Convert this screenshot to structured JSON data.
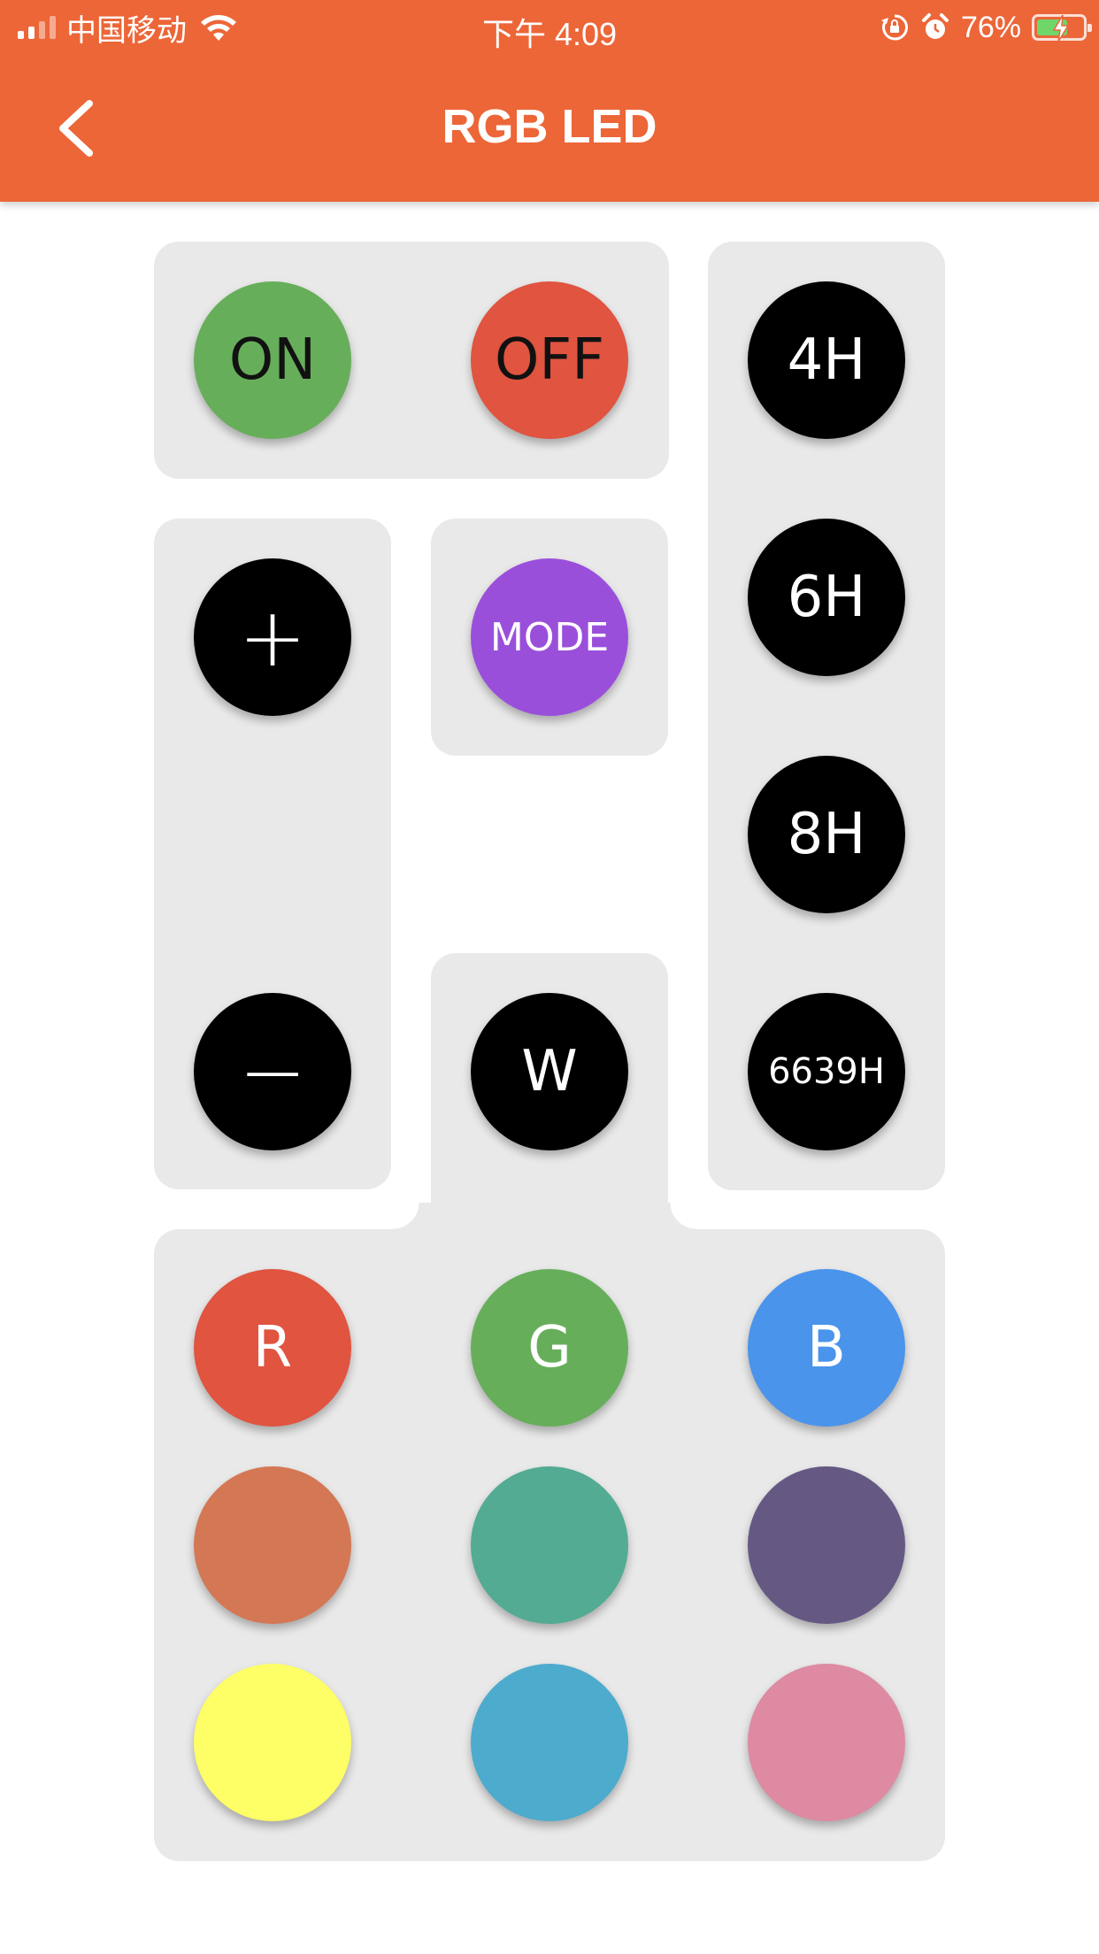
{
  "status_bar": {
    "carrier": "中国移动",
    "time": "下午 4:09",
    "battery": "76%",
    "icons": [
      "signal-icon",
      "wifi-icon",
      "orientation-lock-icon",
      "alarm-icon",
      "battery-charging-icon"
    ]
  },
  "nav": {
    "title": "RGB LED",
    "back_icon": "chevron-left-icon"
  },
  "power": {
    "on_label": "ON",
    "off_label": "OFF",
    "on_color": "#67ae5b",
    "off_color": "#e05440"
  },
  "brightness": {
    "up_label": "+",
    "down_label": "−"
  },
  "mode": {
    "label": "MODE",
    "color": "#9a4fdb"
  },
  "white": {
    "label": "W"
  },
  "timers": [
    {
      "label": "4H"
    },
    {
      "label": "6H"
    },
    {
      "label": "8H"
    },
    {
      "label": "6639H"
    }
  ],
  "colors": [
    {
      "label": "R",
      "color": "#e05440"
    },
    {
      "label": "G",
      "color": "#67ae5b"
    },
    {
      "label": "B",
      "color": "#4a94eb"
    },
    {
      "label": "",
      "color": "#d47754"
    },
    {
      "label": "",
      "color": "#52ab92"
    },
    {
      "label": "",
      "color": "#655984"
    },
    {
      "label": "",
      "color": "#fefe66"
    },
    {
      "label": "",
      "color": "#4dabcd"
    },
    {
      "label": "",
      "color": "#dd8aa2"
    }
  ],
  "theme": {
    "header_bg": "#ec6638",
    "panel_bg": "#e9e9e9",
    "dark_button": "#000000"
  }
}
